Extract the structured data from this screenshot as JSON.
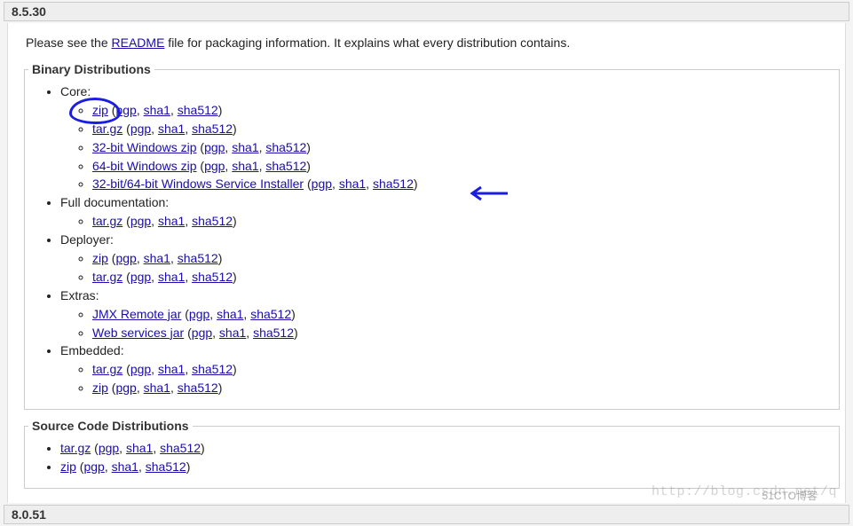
{
  "version_top": "8.5.30",
  "version_bottom": "8.0.51",
  "intro_prefix": "Please see the ",
  "readme_link": "README",
  "intro_suffix": " file for packaging information. It explains what every distribution contains.",
  "sections": {
    "binary": {
      "legend": "Binary Distributions",
      "core": {
        "label": "Core:",
        "items": [
          {
            "name": "zip",
            "sigs": [
              "pgp",
              "sha1",
              "sha512"
            ]
          },
          {
            "name": "tar.gz",
            "sigs": [
              "pgp",
              "sha1",
              "sha512"
            ]
          },
          {
            "name": "32-bit Windows zip",
            "sigs": [
              "pgp",
              "sha1",
              "sha512"
            ]
          },
          {
            "name": "64-bit Windows zip",
            "sigs": [
              "pgp",
              "sha1",
              "sha512"
            ]
          },
          {
            "name": "32-bit/64-bit Windows Service Installer",
            "sigs": [
              "pgp",
              "sha1",
              "sha512"
            ]
          }
        ]
      },
      "fulldoc": {
        "label": "Full documentation:",
        "items": [
          {
            "name": "tar.gz",
            "sigs": [
              "pgp",
              "sha1",
              "sha512"
            ]
          }
        ]
      },
      "deployer": {
        "label": "Deployer:",
        "items": [
          {
            "name": "zip",
            "sigs": [
              "pgp",
              "sha1",
              "sha512"
            ]
          },
          {
            "name": "tar.gz",
            "sigs": [
              "pgp",
              "sha1",
              "sha512"
            ]
          }
        ]
      },
      "extras": {
        "label": "Extras:",
        "items": [
          {
            "name": "JMX Remote jar",
            "sigs": [
              "pgp",
              "sha1",
              "sha512"
            ]
          },
          {
            "name": "Web services jar",
            "sigs": [
              "pgp",
              "sha1",
              "sha512"
            ]
          }
        ]
      },
      "embedded": {
        "label": "Embedded:",
        "items": [
          {
            "name": "tar.gz",
            "sigs": [
              "pgp",
              "sha1",
              "sha512"
            ]
          },
          {
            "name": "zip",
            "sigs": [
              "pgp",
              "sha1",
              "sha512"
            ]
          }
        ]
      }
    },
    "source": {
      "legend": "Source Code Distributions",
      "items": [
        {
          "name": "tar.gz",
          "sigs": [
            "pgp",
            "sha1",
            "sha512"
          ]
        },
        {
          "name": "zip",
          "sigs": [
            "pgp",
            "sha1",
            "sha512"
          ]
        }
      ]
    }
  },
  "watermark": "http://blog.csdn.net/q",
  "badge": "51CTO博客"
}
